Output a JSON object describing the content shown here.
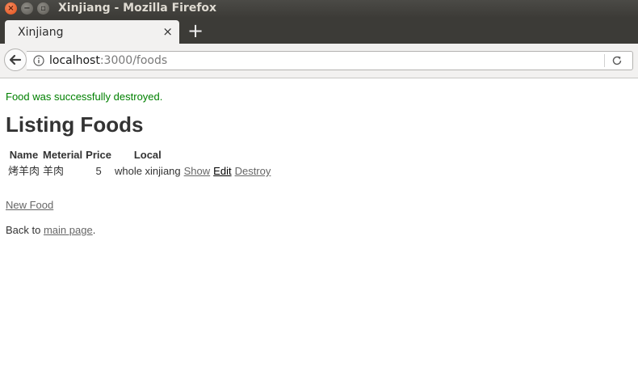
{
  "window": {
    "title": "Xinjiang - Mozilla Firefox",
    "close_glyph": "×",
    "min_glyph": "−",
    "max_glyph": "▫"
  },
  "tabs": [
    {
      "label": "Xinjiang",
      "close_glyph": "×"
    }
  ],
  "newtab_glyph": "+",
  "navbar": {
    "back_icon": "back-arrow-icon",
    "info_icon": "info-icon",
    "reload_icon": "reload-icon",
    "url_host": "localhost",
    "url_path": ":3000/foods"
  },
  "page": {
    "notice": "Food was successfully destroyed.",
    "heading": "Listing Foods",
    "table": {
      "headers": [
        "Name",
        "Meterial",
        "Price",
        "Local"
      ],
      "rows": [
        {
          "name": "烤羊肉",
          "material": "羊肉",
          "price": "5",
          "local": "whole xinjiang",
          "show": "Show",
          "edit": "Edit",
          "destroy": "Destroy"
        }
      ]
    },
    "new_food_link": "New Food",
    "back_prefix": "Back to ",
    "back_link": "main page",
    "back_suffix": "."
  },
  "colors": {
    "notice": "#008000",
    "link": "#666666",
    "titlebar": "#3c3b37",
    "close_button": "#e2511a"
  }
}
